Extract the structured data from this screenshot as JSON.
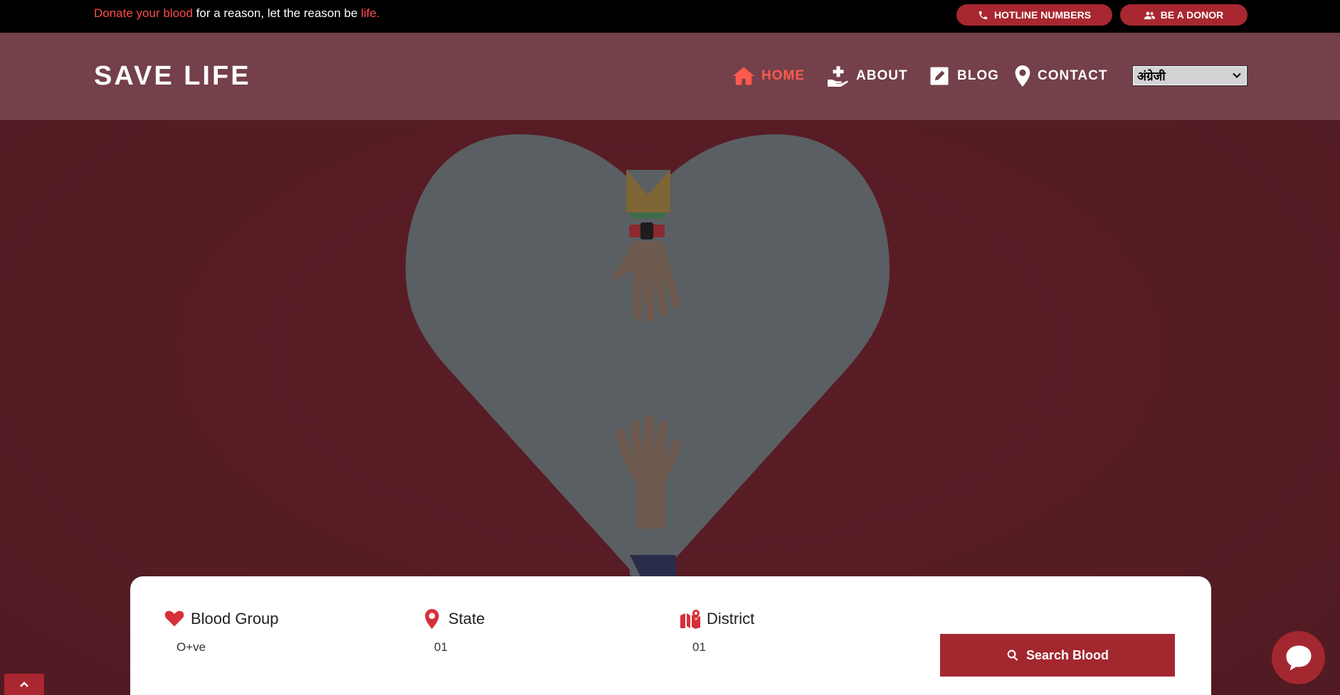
{
  "topbar": {
    "tagline_part1": "Donate your blood",
    "tagline_part2": " for a reason, let the reason be ",
    "tagline_part3": "life.",
    "hotline_label": "HOTLINE NUMBERS",
    "donor_label": "BE A DONOR"
  },
  "nav": {
    "logo": "SAVE LIFE",
    "items": [
      {
        "label": "HOME",
        "icon": "home-icon",
        "active": true
      },
      {
        "label": "ABOUT",
        "icon": "hand-plus-icon",
        "active": false
      },
      {
        "label": "BLOG",
        "icon": "edit-icon",
        "active": false
      },
      {
        "label": "CONTACT",
        "icon": "map-pin-icon",
        "active": false
      }
    ],
    "language_selected": "अंग्रेजी"
  },
  "search": {
    "blood_group_label": "Blood Group",
    "blood_group_value": "O+ve",
    "state_label": "State",
    "state_value": "01",
    "district_label": "District",
    "district_value": "01",
    "button_label": "Search Blood"
  },
  "colors": {
    "accent": "#a3272f",
    "highlight": "#ff4b4b",
    "hero_bg": "#561c24",
    "nav_bg": "#74404a",
    "heart_fill": "#5a5f63"
  }
}
